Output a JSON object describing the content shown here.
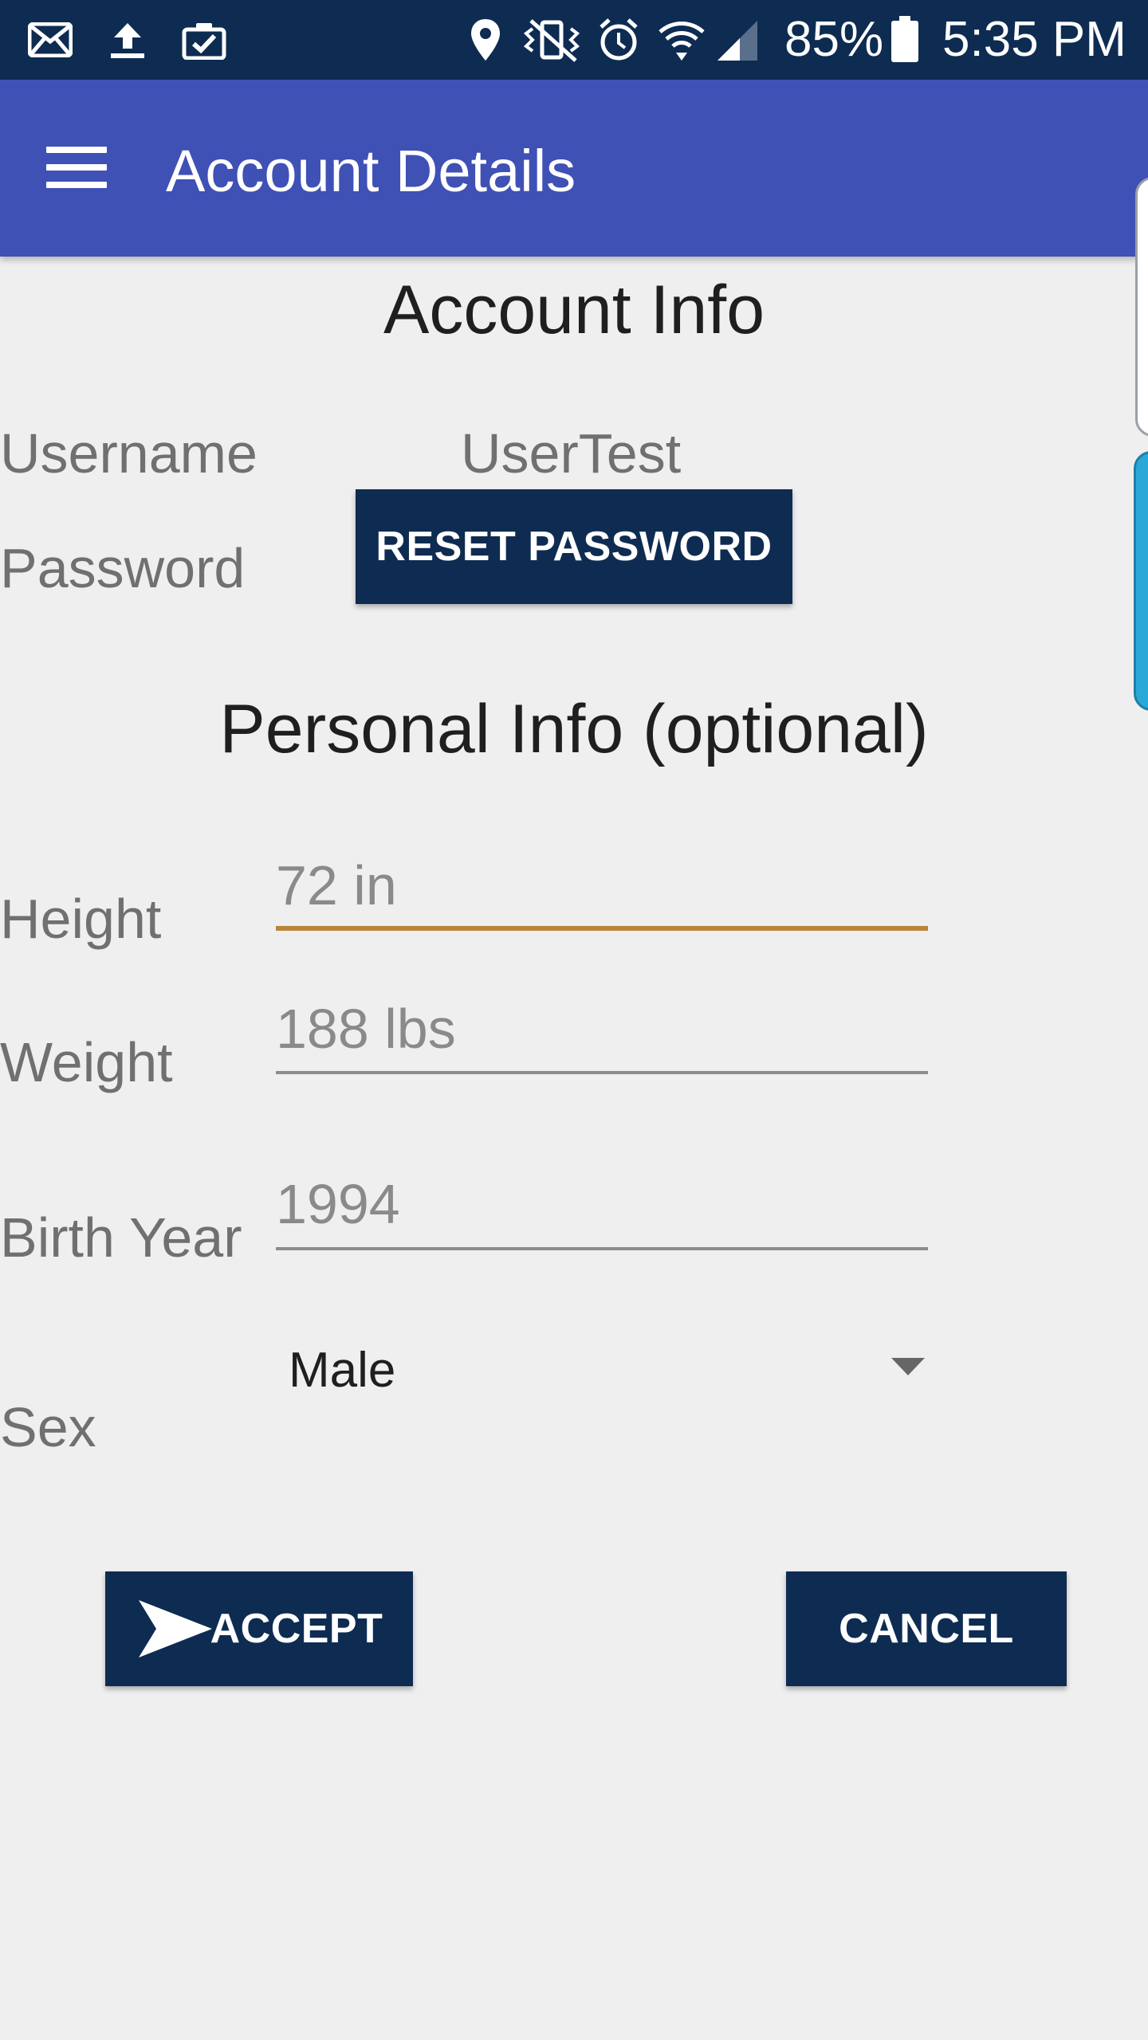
{
  "status_bar": {
    "battery_percent": "85%",
    "time": "5:35 PM",
    "icons": [
      "mail-icon",
      "upload-icon",
      "clipboard-check-icon",
      "location-icon",
      "vibrate-mute-icon",
      "alarm-icon",
      "wifi-icon",
      "signal-icon",
      "battery-icon"
    ]
  },
  "app_bar": {
    "title": "Account Details",
    "menu_icon": "hamburger-menu-icon",
    "color": "#3f51b5"
  },
  "account_info": {
    "heading": "Account Info",
    "username_label": "Username",
    "username_value": "UserTest",
    "password_label": "Password",
    "reset_password_button": "RESET PASSWORD"
  },
  "personal_info": {
    "heading": "Personal Info (optional)",
    "height_label": "Height",
    "height_value": "72 in",
    "weight_label": "Weight",
    "weight_value": "188 lbs",
    "birth_year_label": "Birth Year",
    "birth_year_value": "1994",
    "sex_label": "Sex",
    "sex_value": "Male"
  },
  "actions": {
    "accept_label": "ACCEPT",
    "accept_icon": "send-icon",
    "cancel_label": "CANCEL",
    "button_color": "#0e2c52"
  },
  "colors": {
    "status_bar": "#0e2c52",
    "active_field_underline": "#bb8439",
    "background": "#efefef"
  }
}
